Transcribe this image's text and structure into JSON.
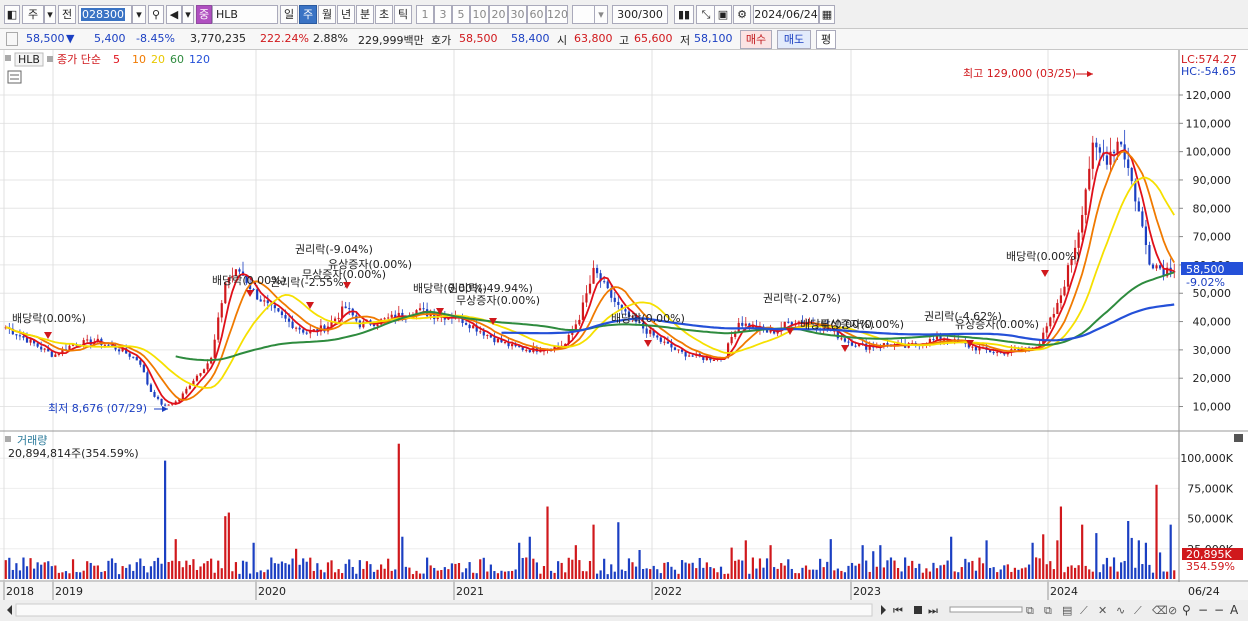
{
  "toolbar": {
    "market_select": "주",
    "prev_button": "전",
    "code_input": "028300",
    "sector_badge": "중",
    "stock_name": "HLB",
    "period_tabs": [
      "일",
      "주",
      "월",
      "년",
      "분",
      "초",
      "틱"
    ],
    "active_period": "주",
    "minute_values": [
      "1",
      "3",
      "5",
      "10",
      "20",
      "30",
      "60",
      "120"
    ],
    "count_display": "300/300",
    "date_input": "2024/06/24"
  },
  "quote": {
    "price": "58,500",
    "change_arrow": "▼",
    "change": "5,400",
    "change_pct": "-8.45%",
    "volume": "3,770,235",
    "vol_ratio": "222.24%",
    "turnover": "2.88%",
    "amount": "229,999백만",
    "ask_label": "호가",
    "ask": "58,500",
    "bid": "58,400",
    "open_label": "시",
    "open": "63,800",
    "high_label": "고",
    "high": "65,600",
    "low_label": "저",
    "low": "58,100",
    "buy_button": "매수",
    "sell_button": "매도",
    "eval_button": "평"
  },
  "price_panel": {
    "name_tag": "HLB",
    "ma_label": "종가 단순",
    "ma_periods": [
      "5",
      "10",
      "20",
      "60",
      "120"
    ],
    "lc_label": "LC:574.27",
    "hc_label": "HC:-54.65",
    "current_price_label": "58,500",
    "current_pct_label": "-9.02%",
    "max_annotation": "최고 129,000 (03/25)",
    "min_annotation": "최저 8,676 (07/29)",
    "y_ticks": [
      "120,000",
      "110,000",
      "100,000",
      "90,000",
      "80,000",
      "70,000",
      "60,000",
      "50,000",
      "40,000",
      "30,000",
      "20,000",
      "10,000"
    ],
    "events": [
      "배당락(0.00%)",
      "배당락(0.00%)",
      "권리락(-2.55%)",
      "권리락(-9.04%)",
      "유상증자(0.00%)",
      "무상증자(0.00%)",
      "배당락(0.00%)",
      "권리락(-49.94%)",
      "무상증자(0.00%)",
      "배당락(0.00%)",
      "권리락(-2.07%)",
      "배당락(0.00%)",
      "무상증자(0.00%)",
      "권리락(-4.62%)",
      "유상증자(0.00%)",
      "배당락(0.00%)"
    ]
  },
  "volume_panel": {
    "title": "거래량",
    "summary": "20,894,814주(354.59%)",
    "y_ticks": [
      "100,000K",
      "75,000K",
      "50,000K",
      "25,000K"
    ],
    "current_label": "20,895K",
    "current_pct": "354.59%"
  },
  "x_axis": {
    "years": [
      "2018",
      "2019",
      "2020",
      "2021",
      "2022",
      "2023",
      "2024"
    ],
    "right_label": "06/24"
  },
  "colors": {
    "up": "#d0181c",
    "down": "#1b3fc2",
    "ma5": "#e0101a",
    "ma10": "#f07a00",
    "ma20": "#f6e000",
    "ma60": "#2e8b3e",
    "ma120": "#2450d8"
  }
}
